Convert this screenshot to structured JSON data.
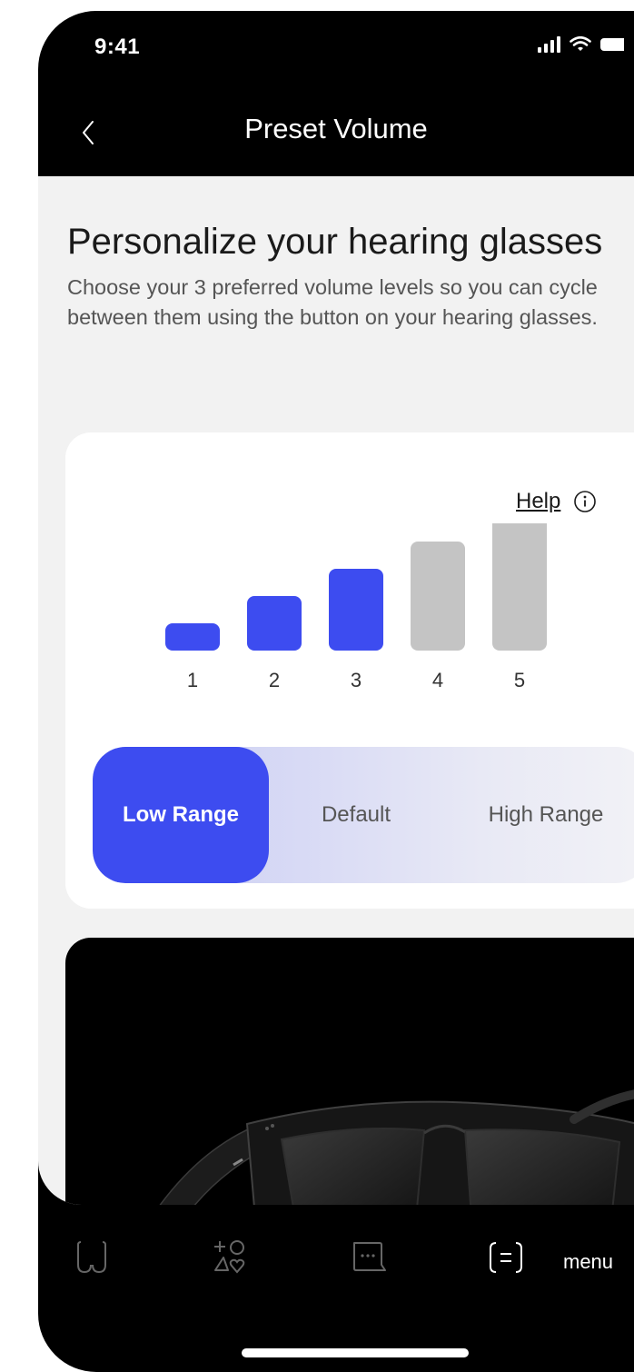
{
  "status_bar": {
    "time": "9:41"
  },
  "header": {
    "title": "Preset Volume"
  },
  "main": {
    "title": "Personalize your hearing glasses",
    "description": "Choose your 3 preferred volume levels so you can cycle between them using the button on your hearing glasses."
  },
  "volume_card": {
    "help_label": "Help",
    "levels": [
      {
        "label": "1",
        "selected": true
      },
      {
        "label": "2",
        "selected": true
      },
      {
        "label": "3",
        "selected": true
      },
      {
        "label": "4",
        "selected": false
      },
      {
        "label": "5",
        "selected": false
      }
    ],
    "range_options": [
      {
        "label": "Low Range",
        "active": true
      },
      {
        "label": "Default",
        "active": false
      },
      {
        "label": "High Range",
        "active": false
      }
    ]
  },
  "bottom_nav": {
    "items": [
      {
        "icon": "glasses-icon"
      },
      {
        "icon": "health-icon"
      },
      {
        "icon": "chat-icon"
      },
      {
        "icon": "menu-icon",
        "label": "menu"
      }
    ]
  },
  "colors": {
    "accent": "#3d4cf0",
    "inactive_bar": "#c4c4c4",
    "background": "#f2f2f2",
    "chrome": "#000000"
  }
}
